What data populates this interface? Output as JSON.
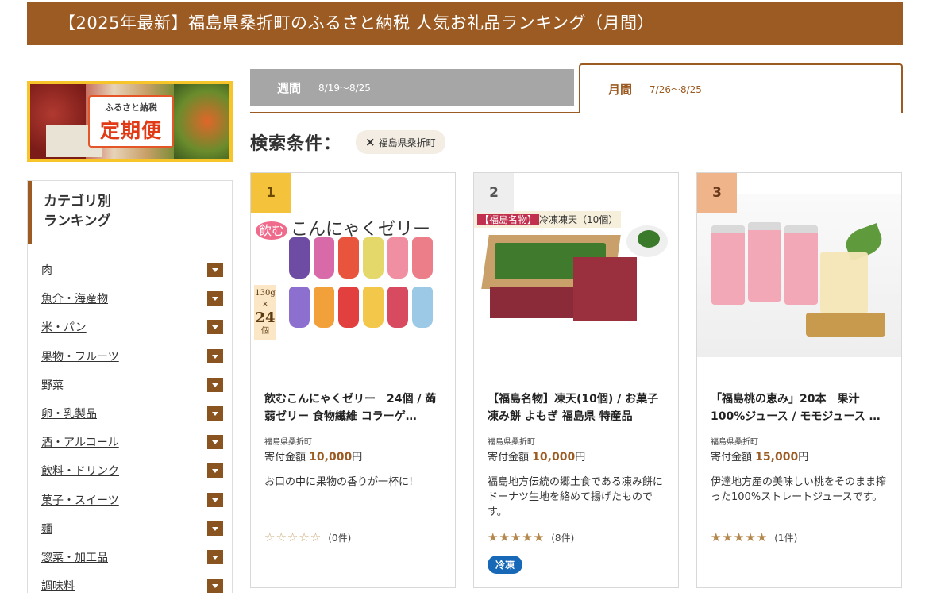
{
  "header": {
    "title": "【2025年最新】福島県桑折町のふるさと納税 人気お礼品ランキング（月間）"
  },
  "banner": {
    "sub": "ふるさと納税",
    "main": "定期便"
  },
  "sidebar": {
    "title_line1": "カテゴリ別",
    "title_line2": "ランキング",
    "items": [
      {
        "label": "肉"
      },
      {
        "label": "魚介・海産物"
      },
      {
        "label": "米・パン"
      },
      {
        "label": "果物・フルーツ"
      },
      {
        "label": "野菜"
      },
      {
        "label": "卵・乳製品"
      },
      {
        "label": "酒・アルコール"
      },
      {
        "label": "飲料・ドリンク"
      },
      {
        "label": "菓子・スイーツ"
      },
      {
        "label": "麺"
      },
      {
        "label": "惣菜・加工品"
      },
      {
        "label": "調味料"
      }
    ]
  },
  "tabs": {
    "weekly": {
      "label": "週間",
      "date": "8/19〜8/25"
    },
    "monthly": {
      "label": "月間",
      "date": "7/26〜8/25"
    }
  },
  "search": {
    "label": "検索条件：",
    "chip_x": "×",
    "chip": "福島県桑折町"
  },
  "cards": [
    {
      "rank": "1",
      "img_head": "飲む",
      "img_title": "こんにゃくゼリー",
      "img_count_top": "130g",
      "img_count_mid": "×",
      "img_count_num": "24",
      "img_count_unit": "個",
      "title": "飲むこんにゃくゼリー　24個 / 蒟蒻ゼリー 食物繊維 コラーゲ…",
      "municipality": "福島県桑折町",
      "price_label": "寄付金額",
      "price": "10,000",
      "price_unit": "円",
      "desc": "お口の中に果物の香りが一杯に!",
      "stars": "☆☆☆☆☆",
      "rating_value": 0,
      "reviews": "(0件)"
    },
    {
      "rank": "2",
      "img_head_box": "【福島名物】",
      "img_head": "冷凍凍天（10個）",
      "title": "【福島名物】凍天(10個) / お菓子 凍み餅 よもぎ 福島県 特産品",
      "municipality": "福島県桑折町",
      "price_label": "寄付金額",
      "price": "10,000",
      "price_unit": "円",
      "desc": "福島地方伝統の郷土食である凍み餅にドーナツ生地を絡めて揚げたものです。",
      "stars": "★★★★★",
      "rating_value": 5,
      "reviews": "(8件)",
      "badge": "冷凍"
    },
    {
      "rank": "3",
      "title": "「福島桃の恵み」20本　果汁100%ジュース / モモジュース …",
      "municipality": "福島県桑折町",
      "price_label": "寄付金額",
      "price": "15,000",
      "price_unit": "円",
      "desc": "伊達地方産の美味しい桃をそのまま搾った100%ストレートジュースです。",
      "stars": "★★★★★",
      "rating_value": 5,
      "reviews": "(1件)"
    }
  ],
  "colors": {
    "brand": "#9c5b22",
    "badge": "#1769b8",
    "rank1": "#f5c33b",
    "rank3": "#f0b48a"
  }
}
